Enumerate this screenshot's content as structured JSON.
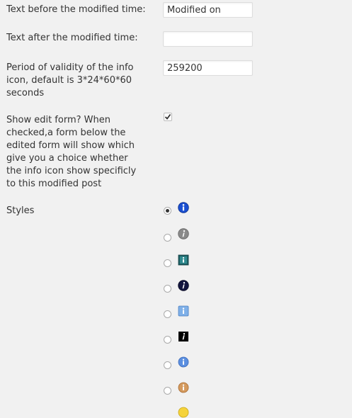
{
  "settings": {
    "text_before_label": "Text before the modified time:",
    "text_before_value": "Modified on",
    "text_after_label": "Text after the modified time:",
    "text_after_value": "",
    "validity_label": "Period of validity of the info icon, default is 3*24*60*60 seconds",
    "validity_value": "259200",
    "show_edit_form_label": "Show edit form? When checked,a form below the edited form will show which give you a choice whether the info icon show specificly to this modified post",
    "show_edit_form_checked": true,
    "styles_label": "Styles",
    "styles_selected_index": 0,
    "style_icons": [
      "info-blue-circle-icon",
      "info-gray-circle-icon",
      "info-teal-square-icon",
      "info-dark-circle-icon",
      "info-lightblue-square-icon",
      "info-black-square-icon",
      "info-lightblue-circle-icon",
      "info-bronze-circle-icon",
      "info-yellow-circle-icon"
    ]
  }
}
